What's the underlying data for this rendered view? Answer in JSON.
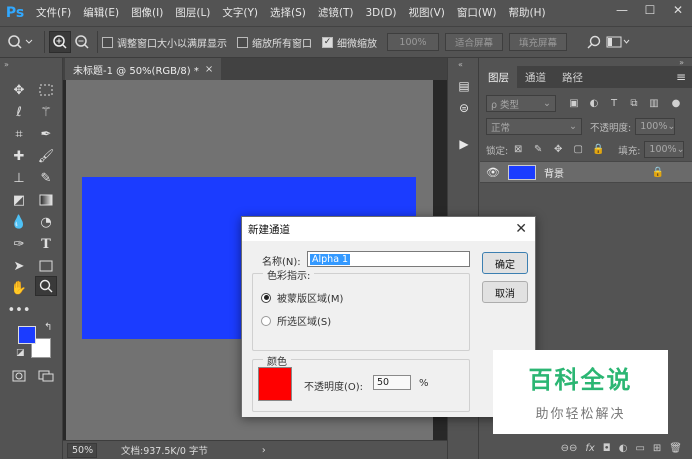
{
  "app": {
    "logo": "Ps"
  },
  "menu": [
    "文件(F)",
    "编辑(E)",
    "图像(I)",
    "图层(L)",
    "文字(Y)",
    "选择(S)",
    "滤镜(T)",
    "3D(D)",
    "视图(V)",
    "窗口(W)",
    "帮助(H)"
  ],
  "window_controls": {
    "minimize": "—",
    "restore": "☐",
    "close": "✕"
  },
  "options": {
    "check_resize": {
      "label": "调整窗口大小以满屏显示",
      "checked": false
    },
    "check_zoom_all": {
      "label": "缩放所有窗口",
      "checked": false
    },
    "check_scrubby": {
      "label": "细微缩放",
      "checked": true
    },
    "zoom_field": "100%",
    "fit_screen": "适合屏幕",
    "fill_screen": "填充屏幕"
  },
  "document": {
    "tab_title": "未标题-1 @ 50%(RGB/8) *",
    "tab_close": "×",
    "zoom": "50%",
    "doc_info": "文档:937.5K/0 字节",
    "nav_arrow": "›"
  },
  "layers_panel": {
    "tabs": [
      "图层",
      "通道",
      "路径"
    ],
    "menu_icon": "≡",
    "filter_kind": "ρ 类型",
    "blend_mode": "正常",
    "opacity_label": "不透明度:",
    "opacity_value": "100%",
    "lock_label": "锁定:",
    "fill_label": "填充:",
    "fill_value": "100%",
    "layers": [
      {
        "name": "背景",
        "visible": true,
        "locked": true,
        "thumb_color": "#1b3cff"
      }
    ],
    "footer_icons": [
      "link-icon",
      "fx-icon",
      "mask-icon",
      "adjustment-icon",
      "group-icon",
      "new-layer-icon",
      "trash-icon"
    ],
    "footer_glyphs": [
      "⊖⊖",
      "fx",
      "◘",
      "◐",
      "▭",
      "⊞",
      "🗑"
    ]
  },
  "dialog": {
    "title": "新建通道",
    "close": "✕",
    "name_label": "名称(N):",
    "name_value": "Alpha 1",
    "ok": "确定",
    "cancel": "取消",
    "color_indicates": {
      "title": "色彩指示:",
      "options": [
        {
          "label": "被蒙版区域(M)",
          "selected": true
        },
        {
          "label": "所选区域(S)",
          "selected": false
        }
      ]
    },
    "color_group": {
      "title": "颜色",
      "swatch_color": "#ff0000",
      "opacity_label": "不透明度(O):",
      "opacity_value": "50",
      "opacity_unit": "%"
    }
  },
  "canvas": {
    "background_color": "#727272",
    "content_color": "#1b3cff"
  },
  "watermark": {
    "title": "百科全说",
    "subtitle": "助你轻松解决"
  },
  "colors": {
    "foreground": "#1b3cff",
    "background": "#ffffff",
    "accent": "#31a8ff"
  }
}
